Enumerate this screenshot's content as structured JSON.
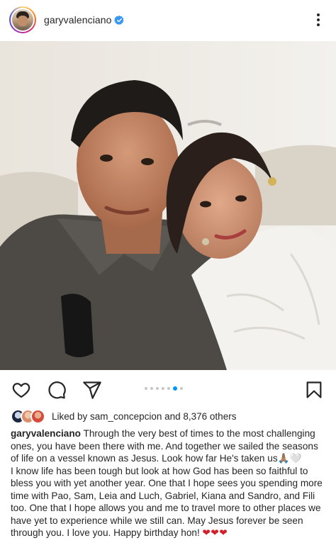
{
  "post": {
    "username": "garyvalenciano",
    "verified": true,
    "carousel": {
      "count": 7,
      "active_index": 5
    }
  },
  "likes": {
    "prefix": "Liked by ",
    "user": "sam_concepcion",
    "middle": " and ",
    "others": "8,376 others"
  },
  "caption": {
    "user": "garyvalenciano",
    "part1": " Through the very best of times to the most challenging ones, you have been there with me. And together we sailed the seasons of life on a vessel known as Jesus. Look how far He's taken us🙏🏽🤍",
    "part2": "I know life has been tough but look at how God has been so faithful to bless you with yet another year. One that I hope sees you spending more time with Pao, Sam, Leia and Luch, Gabriel, Kiana and Sandro, and Fili too. One that I hope allows you and me to travel more to other places we have yet to experience while we still can. May Jesus forever be seen through you. I love you. Happy birthday hon! ",
    "hearts": "❤❤❤"
  },
  "icons": {
    "like": "heart-outline-icon",
    "comment": "comment-bubble-icon",
    "share": "paper-plane-icon",
    "save": "bookmark-icon",
    "more": "more-vertical-icon",
    "verified": "verified-badge-icon"
  },
  "colors": {
    "text": "#262626",
    "verified": "#3897f0",
    "carousel_active": "#0095f6",
    "carousel_inactive": "#c7c7c7",
    "hearts": "#d11f29"
  }
}
